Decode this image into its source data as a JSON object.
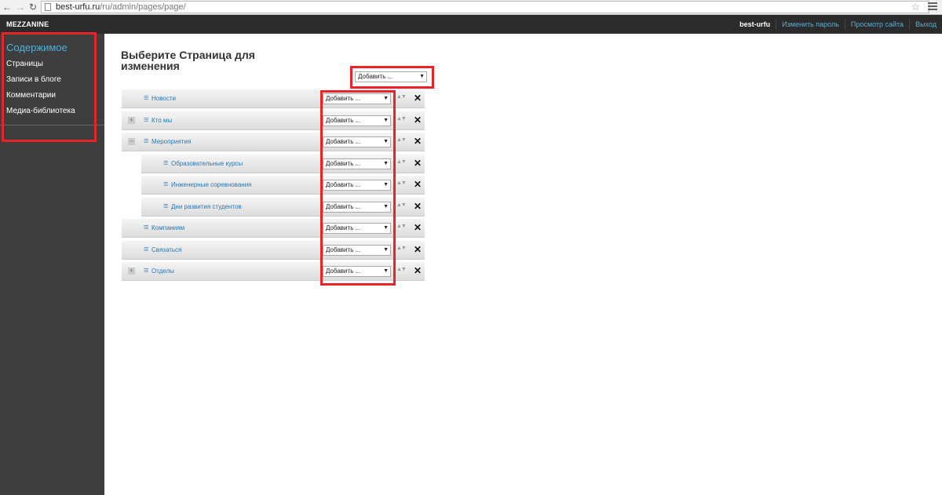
{
  "browser": {
    "url_host": "best-urfu.ru",
    "url_path": "/ru/admin/pages/page/"
  },
  "sidebar": {
    "brand": "MEZZANINE",
    "group_title": "Содержимое",
    "items": [
      {
        "label": "Страницы"
      },
      {
        "label": "Записи в блоге"
      },
      {
        "label": "Комментарии"
      },
      {
        "label": "Медиа-библиотека"
      }
    ]
  },
  "topbar": {
    "user": "best-urfu",
    "change_password": "Изменить пароль",
    "view_site": "Просмотр сайта",
    "logout": "Выход"
  },
  "main": {
    "title": "Выберите Страница для изменения",
    "add_select": "Добавить ..."
  },
  "tree": [
    {
      "label": "Новости",
      "add": "Добавить ...",
      "toggle": ""
    },
    {
      "label": "Кто мы",
      "add": "Добавить ...",
      "toggle": "+"
    },
    {
      "label": "Мероприятия",
      "add": "Добавить ...",
      "toggle": "−"
    },
    {
      "label": "Образовательные курсы",
      "add": "Добавить ...",
      "toggle": ""
    },
    {
      "label": "Инженерные соревнования",
      "add": "Добавить ...",
      "toggle": ""
    },
    {
      "label": "Дни развития студентов",
      "add": "Добавить ...",
      "toggle": ""
    },
    {
      "label": "Компаниям",
      "add": "Добавить ...",
      "toggle": ""
    },
    {
      "label": "Связаться",
      "add": "Добавить ...",
      "toggle": ""
    },
    {
      "label": "Отделы",
      "add": "Добавить ...",
      "toggle": "+"
    }
  ],
  "colors": {
    "accent": "#4fb1d9",
    "link": "#2a77b0",
    "highlight": "#e8232a"
  }
}
